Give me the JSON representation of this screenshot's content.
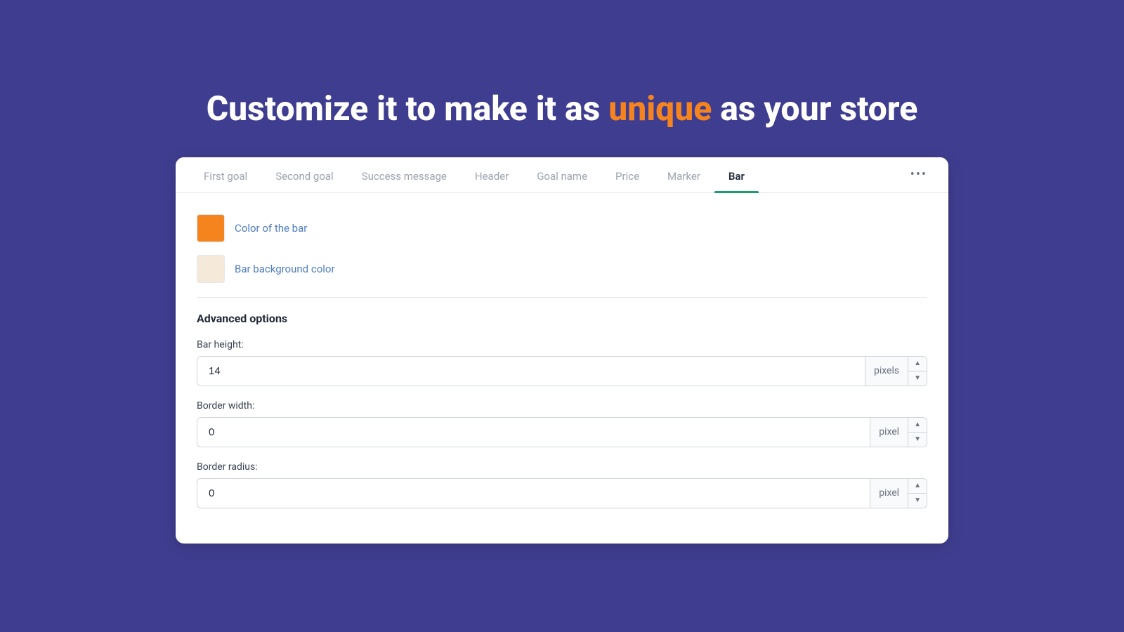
{
  "headline": {
    "prefix": "Customize it to make it as ",
    "highlight": "unique",
    "suffix": " as your store"
  },
  "tabs": {
    "items": [
      {
        "id": "first-goal",
        "label": "First goal",
        "active": false
      },
      {
        "id": "second-goal",
        "label": "Second goal",
        "active": false
      },
      {
        "id": "success-message",
        "label": "Success message",
        "active": false
      },
      {
        "id": "header",
        "label": "Header",
        "active": false
      },
      {
        "id": "goal-name",
        "label": "Goal name",
        "active": false
      },
      {
        "id": "price",
        "label": "Price",
        "active": false
      },
      {
        "id": "marker",
        "label": "Marker",
        "active": false
      },
      {
        "id": "bar",
        "label": "Bar",
        "active": true
      }
    ],
    "more_label": "•••"
  },
  "color_options": {
    "bar_color_label": "Color of the bar",
    "bar_color_value": "#f5841f",
    "bg_color_label": "Bar background color",
    "bg_color_value": "#f5e9d9"
  },
  "advanced": {
    "section_title": "Advanced options",
    "bar_height": {
      "label": "Bar height:",
      "value": 14,
      "unit": "pixels"
    },
    "border_width": {
      "label": "Border width:",
      "value": 0,
      "unit": "pixel"
    },
    "border_radius": {
      "label": "Border radius:",
      "value": 0,
      "unit": "pixel"
    }
  },
  "colors": {
    "accent_green": "#1a9e6e",
    "accent_orange": "#f5841f",
    "active_tab_text": "#1f2937"
  }
}
